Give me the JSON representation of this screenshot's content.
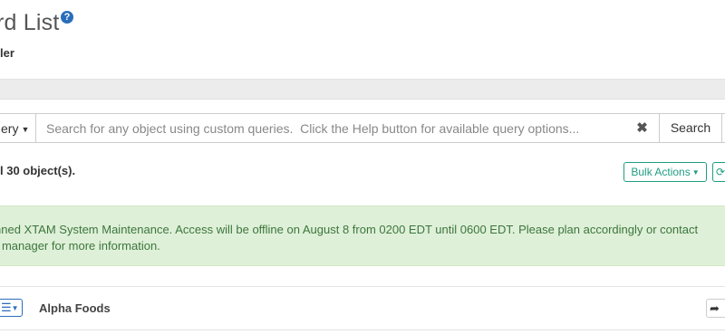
{
  "header": {
    "title": "rd List",
    "help_icon": "question-circle-icon",
    "help_glyph": "?",
    "subtitle": "ler"
  },
  "search": {
    "query_dropdown_label": "ery",
    "placeholder": "Search for any object using custom queries.  Click the Help button for available query options...",
    "value": "",
    "clear_icon": "close-icon",
    "clear_glyph": "✖",
    "button_label": "Search"
  },
  "results": {
    "count_text": "l 30 object(s).",
    "bulk_actions_label": "Bulk Actions",
    "refresh_icon": "refresh-icon",
    "refresh_glyph": "⟳"
  },
  "alert": {
    "line1": "nned XTAM System Maintenance. Access will be offline on August 8 from 0200 EDT until 0600 EDT. Please plan accordingly or contact",
    "line2": "r manager for more information."
  },
  "records": [
    {
      "menu_icon": "list-menu-icon",
      "menu_glyph": "☰",
      "name": "Alpha Foods",
      "share_icon": "share-icon",
      "share_glyph": "➦"
    }
  ],
  "colors": {
    "accent_teal": "#1f9d82",
    "accent_blue": "#2a6ebb",
    "alert_bg": "#dff0d8",
    "alert_text": "#3c763d"
  }
}
